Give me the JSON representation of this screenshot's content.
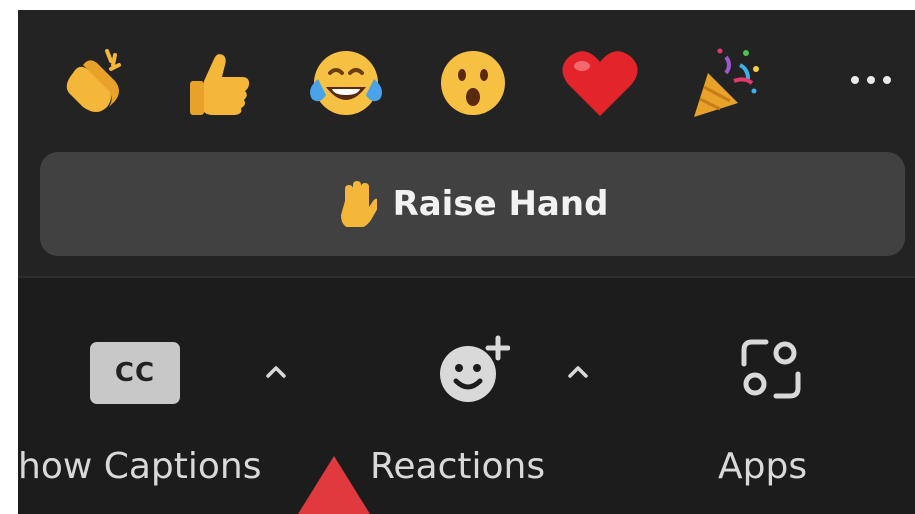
{
  "reactions_popup": {
    "emojis": [
      {
        "name": "clapping-hands",
        "glyph": "👏"
      },
      {
        "name": "thumbs-up",
        "glyph": "👍"
      },
      {
        "name": "tears-of-joy",
        "glyph": "😂"
      },
      {
        "name": "open-mouth",
        "glyph": "😮"
      },
      {
        "name": "red-heart",
        "glyph": "❤️"
      },
      {
        "name": "party-popper",
        "glyph": "🎉"
      }
    ],
    "more_label": "...",
    "raise_hand_label": "Raise Hand"
  },
  "toolbar": {
    "captions_icon_text": "CC",
    "captions_label": "how Captions",
    "reactions_label": "Reactions",
    "apps_label": "Apps"
  },
  "colors": {
    "popup_bg": "#232323",
    "button_bg": "#414141",
    "toolbar_bg": "#1c1c1c",
    "label_text": "#d9d9d9",
    "pointer": "#e0393e"
  }
}
